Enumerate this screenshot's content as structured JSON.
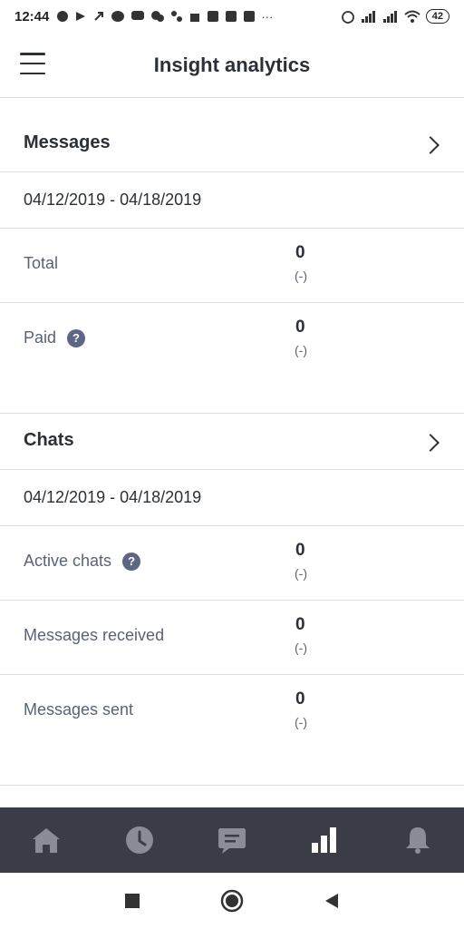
{
  "status_bar": {
    "time": "12:44",
    "battery": "42",
    "dots": "···"
  },
  "header": {
    "title": "Insight analytics"
  },
  "sections": [
    {
      "title": "Messages",
      "date_range": "04/12/2019 - 04/18/2019",
      "metrics": [
        {
          "label": "Total",
          "value": "0",
          "delta": "(-)",
          "help": false
        },
        {
          "label": "Paid",
          "value": "0",
          "delta": "(-)",
          "help": true
        }
      ]
    },
    {
      "title": "Chats",
      "date_range": "04/12/2019 - 04/18/2019",
      "metrics": [
        {
          "label": "Active chats",
          "value": "0",
          "delta": "(-)",
          "help": true
        },
        {
          "label": "Messages received",
          "value": "0",
          "delta": "(-)",
          "help": false
        },
        {
          "label": "Messages sent",
          "value": "0",
          "delta": "(-)",
          "help": false
        }
      ]
    }
  ],
  "help_glyph": "?",
  "bottom_nav": {
    "items": [
      {
        "icon": "home-icon",
        "active": false
      },
      {
        "icon": "clock-icon",
        "active": false
      },
      {
        "icon": "chat-bubble-icon",
        "active": false
      },
      {
        "icon": "bar-chart-icon",
        "active": true
      },
      {
        "icon": "bell-icon",
        "active": false
      }
    ]
  },
  "colors": {
    "nav_bg": "#3a3d45",
    "nav_icon_inactive": "#8a8d96",
    "nav_icon_active": "#ffffff",
    "help_badge": "#5d6685"
  }
}
